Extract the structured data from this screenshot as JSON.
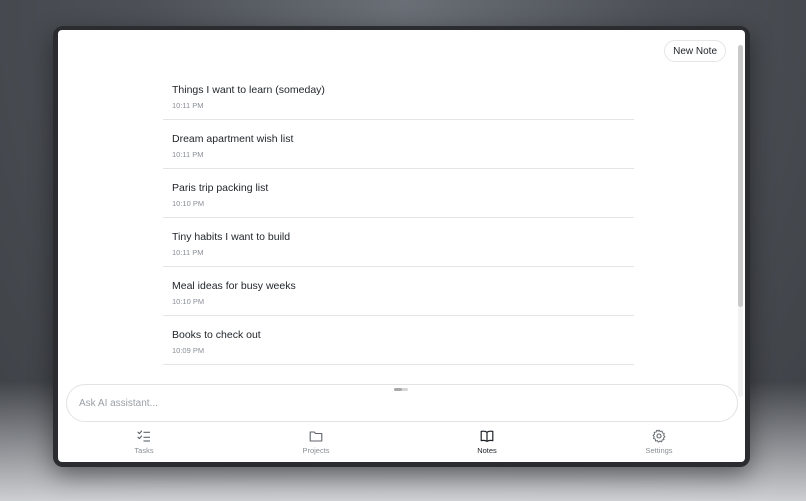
{
  "toolbar": {
    "new_note_label": "New Note"
  },
  "notes": [
    {
      "title": "Things I want to learn (someday)",
      "time": "10:11 PM"
    },
    {
      "title": "Dream apartment wish list",
      "time": "10:11 PM"
    },
    {
      "title": "Paris trip packing list",
      "time": "10:10 PM"
    },
    {
      "title": "Tiny habits I want to build",
      "time": "10:11 PM"
    },
    {
      "title": "Meal ideas for busy weeks",
      "time": "10:10 PM"
    },
    {
      "title": "Books to check out",
      "time": "10:09 PM"
    }
  ],
  "assistant": {
    "placeholder": "Ask AI assistant..."
  },
  "tabs": [
    {
      "label": "Tasks",
      "icon": "checklist-icon",
      "active": false
    },
    {
      "label": "Projects",
      "icon": "folder-icon",
      "active": false
    },
    {
      "label": "Notes",
      "icon": "book-icon",
      "active": true
    },
    {
      "label": "Settings",
      "icon": "gear-icon",
      "active": false
    }
  ]
}
